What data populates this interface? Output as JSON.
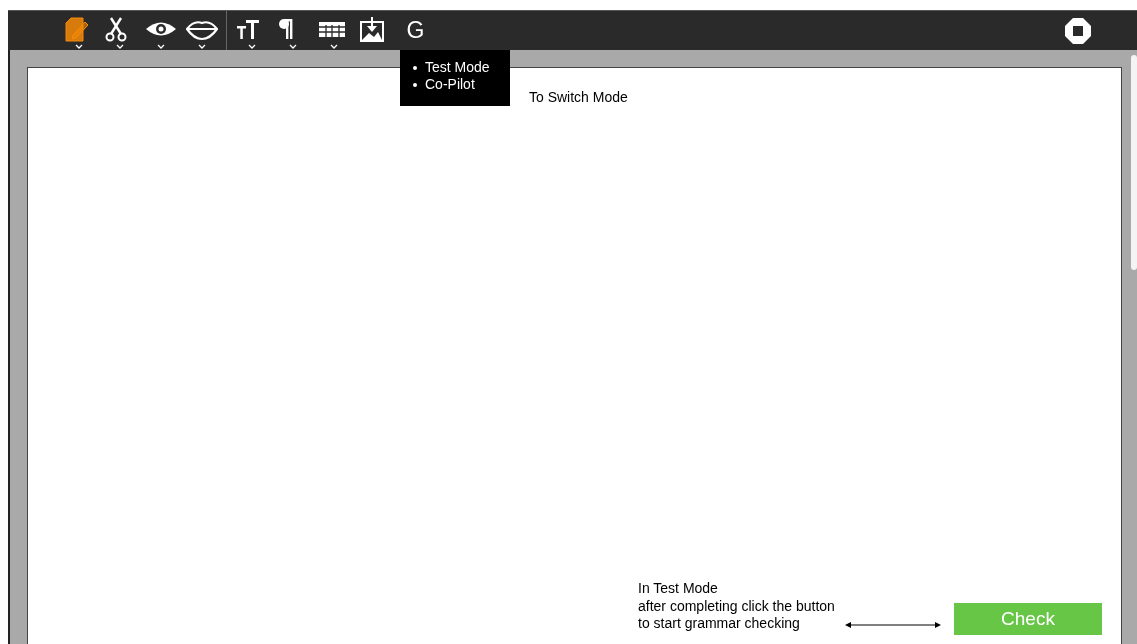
{
  "toolbar": {
    "tools": [
      {
        "kind": "document",
        "caret": true,
        "selected": true
      },
      {
        "kind": "scissors",
        "caret": true,
        "selected": false
      },
      {
        "kind": "eye",
        "caret": true,
        "selected": false
      },
      {
        "kind": "lips",
        "caret": true,
        "selected": false
      },
      {
        "kind": "divider"
      },
      {
        "kind": "text-size",
        "caret": true,
        "selected": false
      },
      {
        "kind": "pilcrow",
        "caret": true,
        "selected": false
      },
      {
        "kind": "table",
        "caret": true,
        "selected": false
      },
      {
        "kind": "image-download",
        "selected": false
      },
      {
        "kind": "letter",
        "label": "G",
        "selected": false
      }
    ]
  },
  "mode_menu": {
    "items": [
      "Test Mode",
      "Co-Pilot"
    ]
  },
  "notes": {
    "switch": "To Switch Mode",
    "check_lines": [
      "In Test Mode",
      "after completing click the button",
      "to start grammar checking"
    ]
  },
  "check_button": {
    "label": "Check"
  }
}
